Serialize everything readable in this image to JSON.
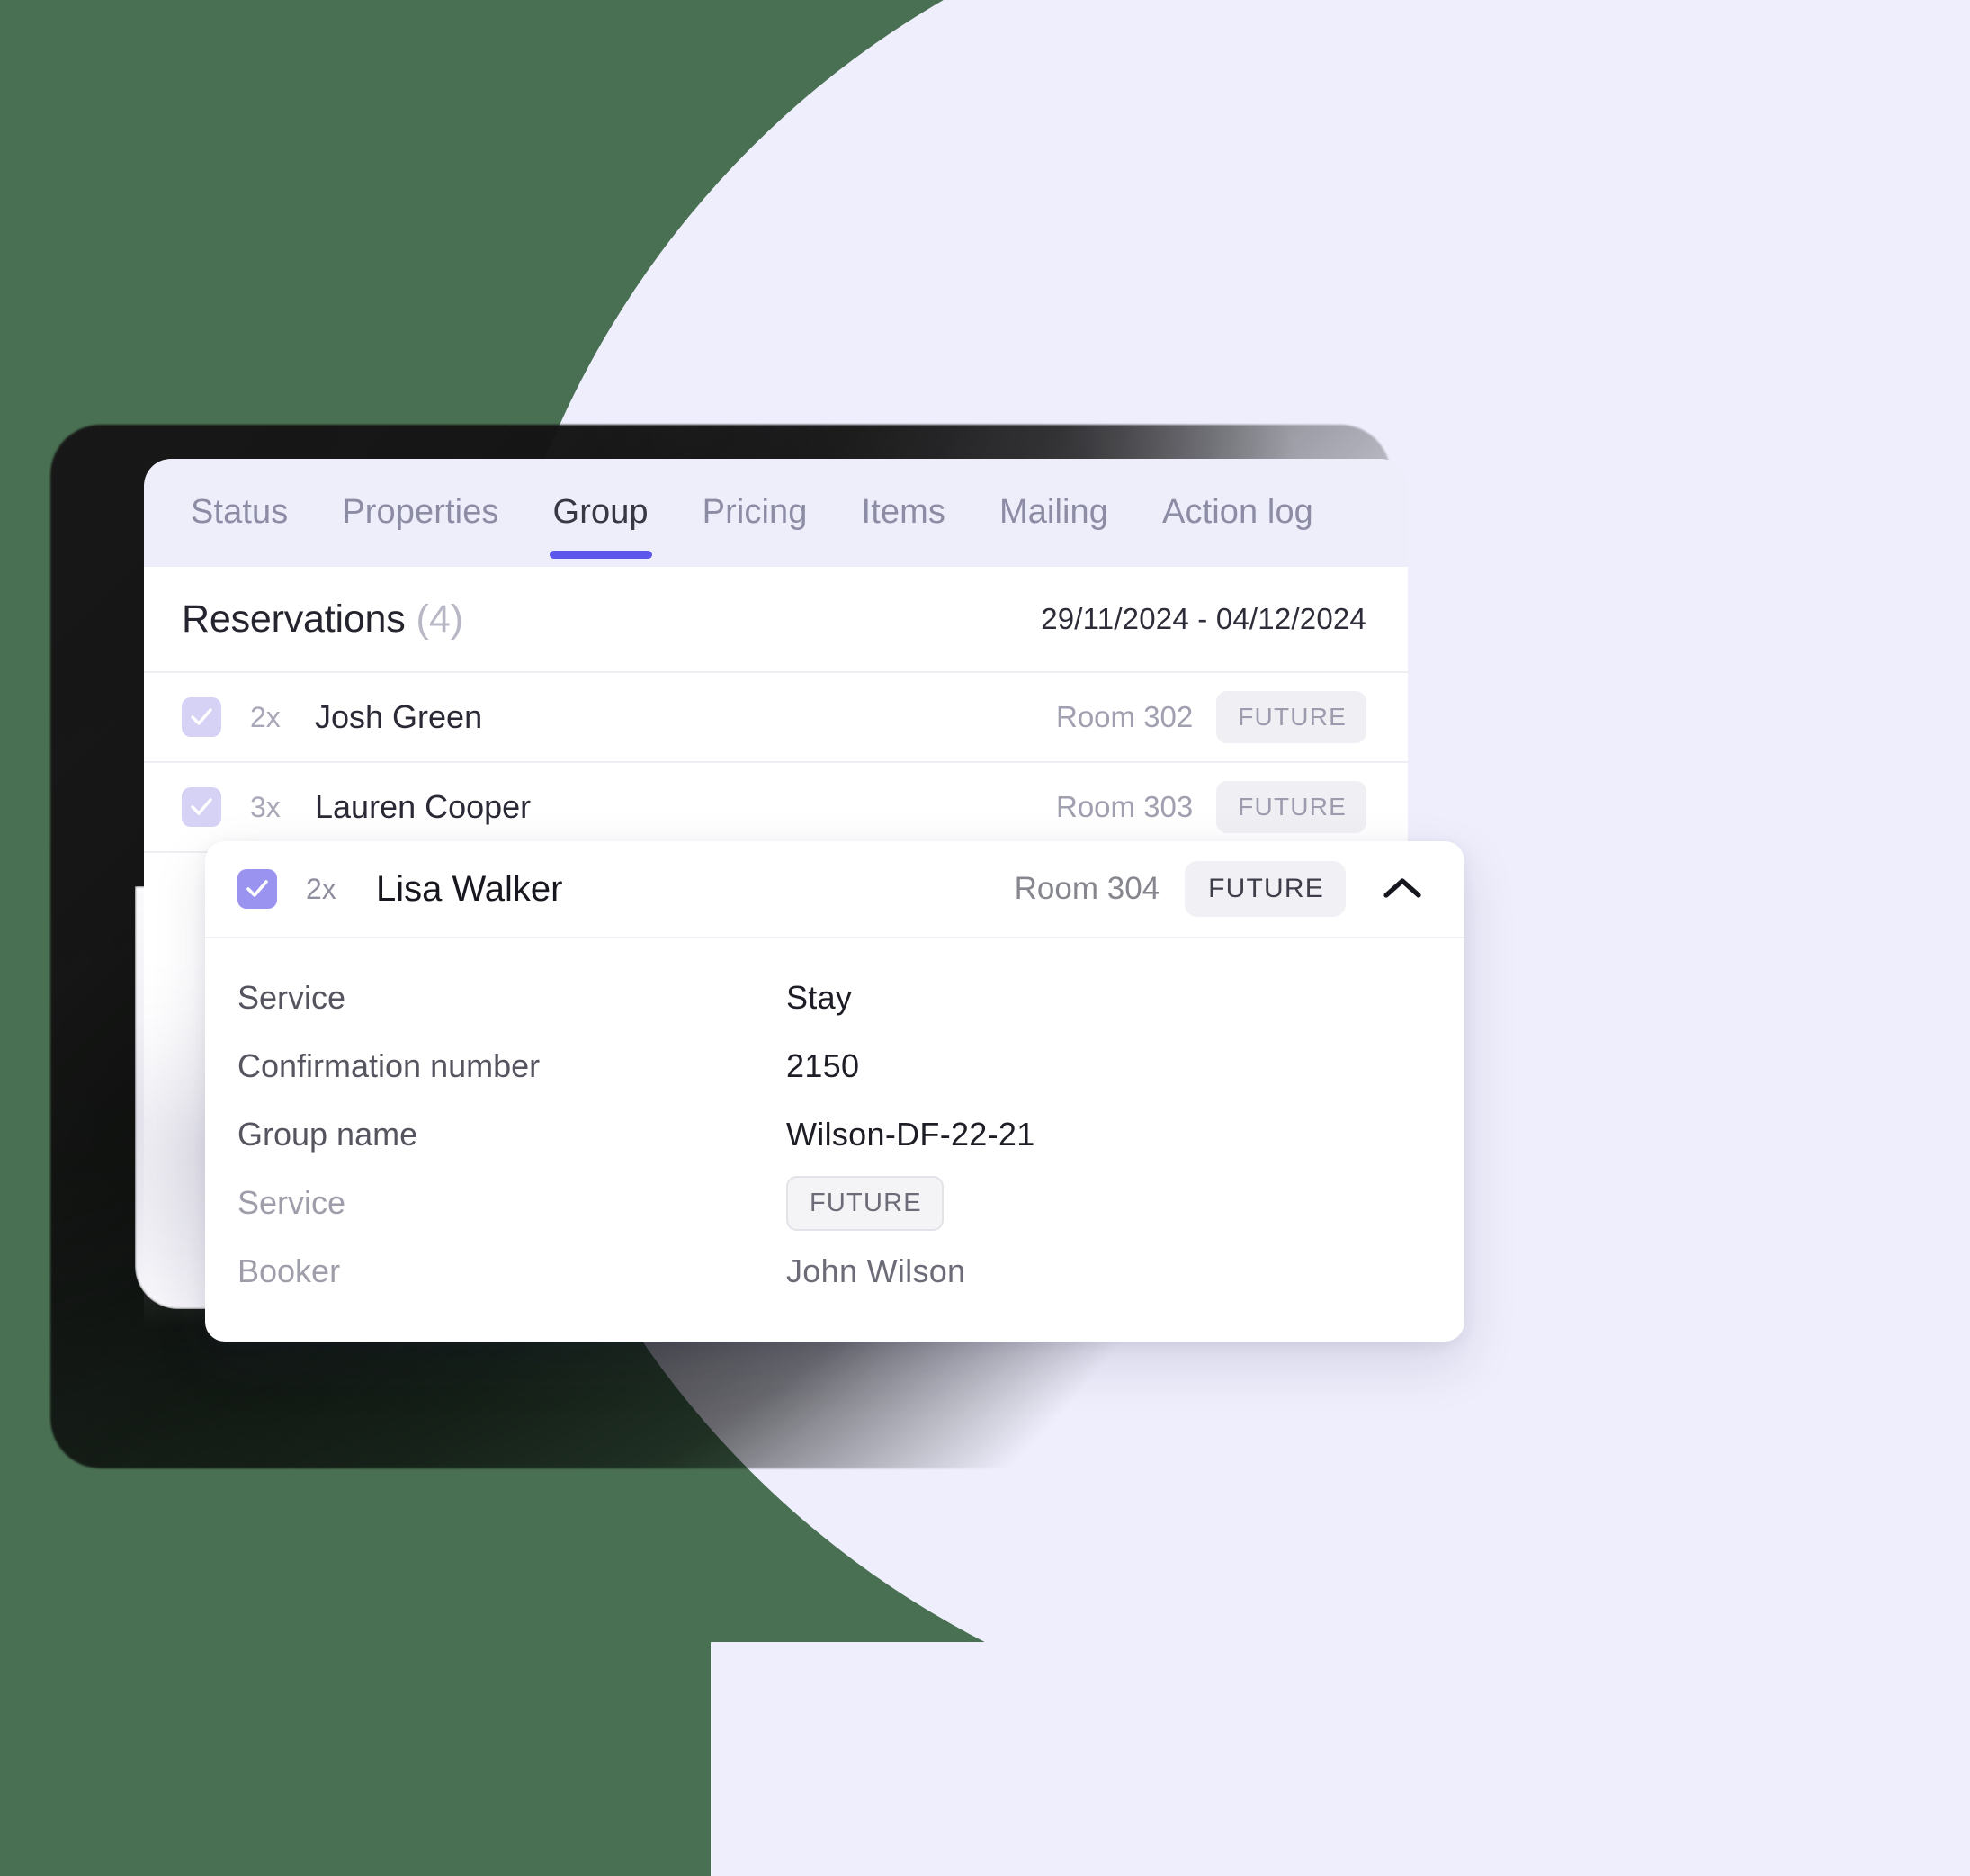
{
  "theme": {
    "page_background": "#4a7053",
    "circle_background": "#eeeefc",
    "accent": "#5d56ec",
    "checkbox_active": "#9b93f0",
    "checkbox_muted": "#d6d2f5",
    "badge_background": "#f0f0f4"
  },
  "tabs": [
    {
      "label": "Status",
      "active": false
    },
    {
      "label": "Properties",
      "active": false
    },
    {
      "label": "Group",
      "active": true
    },
    {
      "label": "Pricing",
      "active": false
    },
    {
      "label": "Items",
      "active": false
    },
    {
      "label": "Mailing",
      "active": false
    },
    {
      "label": "Action log",
      "active": false
    }
  ],
  "reservations_panel": {
    "title": "Reservations",
    "count": "(4)",
    "date_range": "29/11/2024 - 04/12/2024",
    "rows": [
      {
        "qty": "2x",
        "name": "Josh Green",
        "room": "Room 302",
        "status": "FUTURE",
        "checked": true
      },
      {
        "qty": "3x",
        "name": "Lauren Cooper",
        "room": "Room 303",
        "status": "FUTURE",
        "checked": true
      }
    ]
  },
  "detail_card": {
    "header": {
      "qty": "2x",
      "name": "Lisa Walker",
      "room": "Room 304",
      "status": "FUTURE",
      "checked": true,
      "collapse_icon": "chevron-up-icon"
    },
    "rows": [
      {
        "label": "Service",
        "value": "Stay",
        "type": "text",
        "muted": false
      },
      {
        "label": "Confirmation number",
        "value": "2150",
        "type": "text",
        "muted": false
      },
      {
        "label": "Group name",
        "value": "Wilson-DF-22-21",
        "type": "text",
        "muted": false
      },
      {
        "label": "Service",
        "value": "FUTURE",
        "type": "badge",
        "muted": true
      },
      {
        "label": "Booker",
        "value": "John Wilson",
        "type": "text",
        "muted": true
      }
    ]
  }
}
